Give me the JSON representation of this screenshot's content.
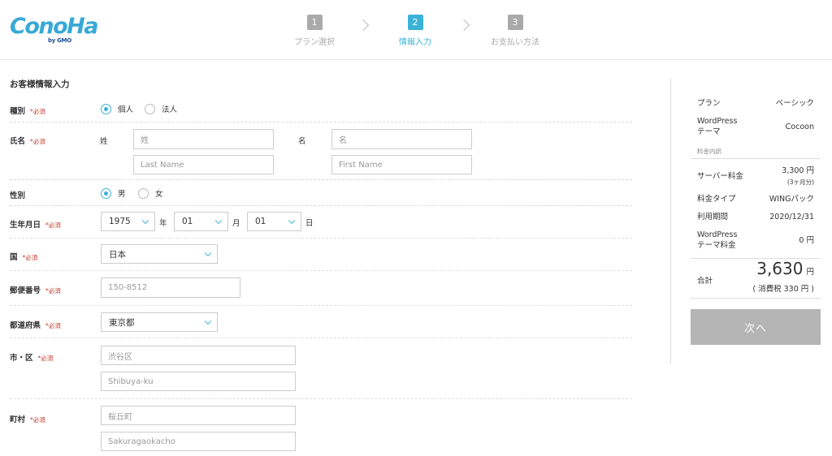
{
  "logo": {
    "text": "ConoHa",
    "sub": "by GMO"
  },
  "steps": [
    {
      "num": "1",
      "label": "プラン選択"
    },
    {
      "num": "2",
      "label": "情報入力"
    },
    {
      "num": "3",
      "label": "お支払い方法"
    }
  ],
  "form": {
    "title": "お客様情報入力",
    "required": "*必須",
    "type": {
      "label": "種別",
      "options": [
        "個人",
        "法人"
      ],
      "selected": "個人"
    },
    "name": {
      "label": "氏名",
      "last_label": "姓",
      "first_label": "名",
      "last_placeholder": "姓",
      "first_placeholder": "名",
      "last_en_placeholder": "Last Name",
      "first_en_placeholder": "First Name"
    },
    "gender": {
      "label": "性別",
      "options": [
        "男",
        "女"
      ],
      "selected": "男"
    },
    "birthday": {
      "label": "生年月日",
      "year": "1975",
      "year_unit": "年",
      "month": "01",
      "month_unit": "月",
      "day": "01",
      "day_unit": "日"
    },
    "country": {
      "label": "国",
      "value": "日本"
    },
    "postal": {
      "label": "郵便番号",
      "placeholder": "150-8512"
    },
    "prefecture": {
      "label": "都道府県",
      "value": "東京都"
    },
    "city": {
      "label": "市・区",
      "placeholder_ja": "渋谷区",
      "placeholder_en": "Shibuya-ku"
    },
    "town": {
      "label": "町村",
      "placeholder_ja": "桜丘町",
      "placeholder_en": "Sakuragaokacho"
    }
  },
  "summary": {
    "plan_label": "プラン",
    "plan_value": "ベーシック",
    "theme_label_1": "WordPress",
    "theme_label_2": "テーマ",
    "theme_value": "Cocoon",
    "fee_header": "料金内訳",
    "server_label": "サーバー料金",
    "server_value": "3,300 円",
    "server_note": "(3ヶ月分)",
    "type_label": "料金タイプ",
    "type_value": "WINGパック",
    "period_label": "利用期間",
    "period_value": "2020/12/31",
    "wp_fee_label_1": "WordPress",
    "wp_fee_label_2": "テーマ料金",
    "wp_fee_value": "0 円",
    "total_label": "合計",
    "total_value": "3,630",
    "total_unit": "円",
    "tax_note": "( 消費税 330 円 )"
  },
  "next_button": "次へ",
  "colors": {
    "accent": "#3bb3d8",
    "required": "#c0392b",
    "button_disabled": "#b5b5b5"
  }
}
